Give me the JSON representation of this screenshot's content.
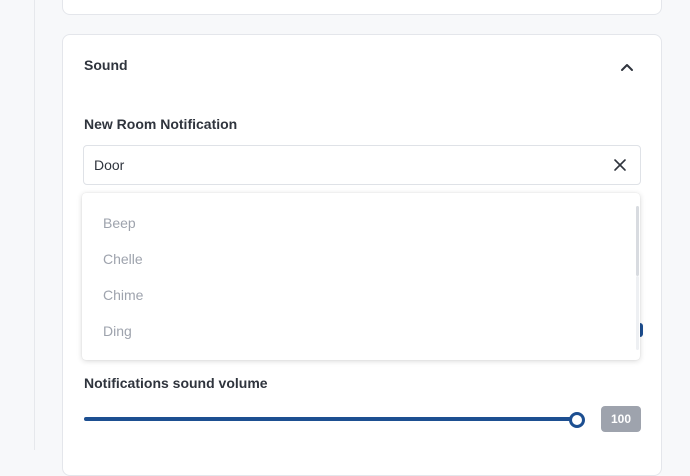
{
  "sound_section": {
    "title": "Sound",
    "collapse_icon": "chevron-up-icon"
  },
  "new_room_notification": {
    "label": "New Room Notification",
    "selected_value": "Door",
    "clear_icon": "close-icon",
    "options": [
      "Beep",
      "Chelle",
      "Chime",
      "Ding"
    ]
  },
  "volume": {
    "label": "Notifications sound volume",
    "value": "100",
    "level": 100
  },
  "colors": {
    "accent": "#1d4f91",
    "muted_text": "#9ea3ad",
    "badge_bg": "#9ea3ad"
  }
}
